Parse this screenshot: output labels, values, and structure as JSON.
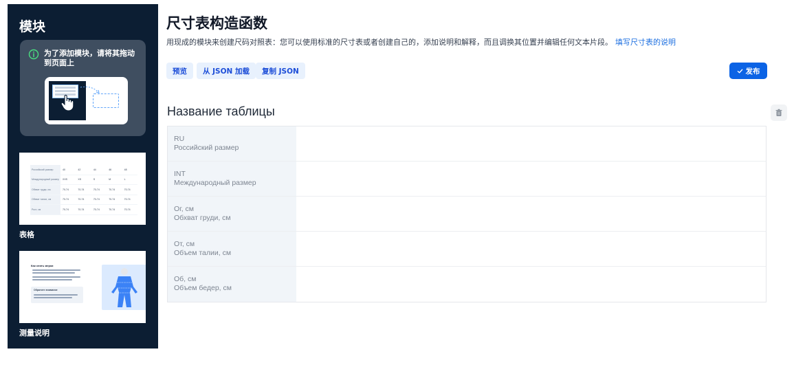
{
  "sidebar": {
    "title": "模块",
    "hint": "为了添加模块，请将其拖动到页面上",
    "blocks": [
      {
        "label": "表格"
      },
      {
        "label": "测量说明"
      }
    ],
    "table_preview": {
      "rows": [
        [
          "Российский размер",
          "40",
          "42",
          "44",
          "46",
          "48"
        ],
        [
          "Международный размер",
          "XXS",
          "XS",
          "S",
          "M",
          "L"
        ],
        [
          "Обхват груди, см",
          "70-74",
          "70-74",
          "70-74",
          "70-74",
          "70-74"
        ],
        [
          "Обхват талии, см",
          "70-74",
          "70-74",
          "70-74",
          "70-74",
          "70-74"
        ],
        [
          "Рост, см",
          "70-74",
          "70-74",
          "70-74",
          "70-74",
          "70-74"
        ]
      ]
    },
    "measure_preview": {
      "title": "Как снять мерки",
      "box_title": "Обратите внимание"
    }
  },
  "header": {
    "title": "尺寸表构造函数",
    "description": "用现成的模块来创建尺码对照表：您可以使用标准的尺寸表或者创建自己的，添加说明和解释，而且调换其位置并编辑任何文本片段。",
    "link": "填写尺寸表的说明"
  },
  "toolbar": {
    "preview": "预览",
    "load_json": "从 JSON 加载",
    "copy_json": "复制 JSON",
    "publish": "发布"
  },
  "table": {
    "title": "Название таблицы",
    "rows": [
      {
        "code": "RU",
        "name": "Российский размер"
      },
      {
        "code": "INT",
        "name": "Международный размер"
      },
      {
        "code": "Ог, см",
        "name": "Обхват груди, см"
      },
      {
        "code": "От, см",
        "name": "Объем талии, см"
      },
      {
        "code": "Об, см",
        "name": "Объем бедер, см"
      }
    ]
  },
  "colors": {
    "sidebar_bg": "#0c1e33",
    "accent": "#0b63e5",
    "chip_bg": "#e8f1fd"
  },
  "icons": [
    "info-icon",
    "check-icon",
    "trash-icon",
    "hand-icon"
  ]
}
